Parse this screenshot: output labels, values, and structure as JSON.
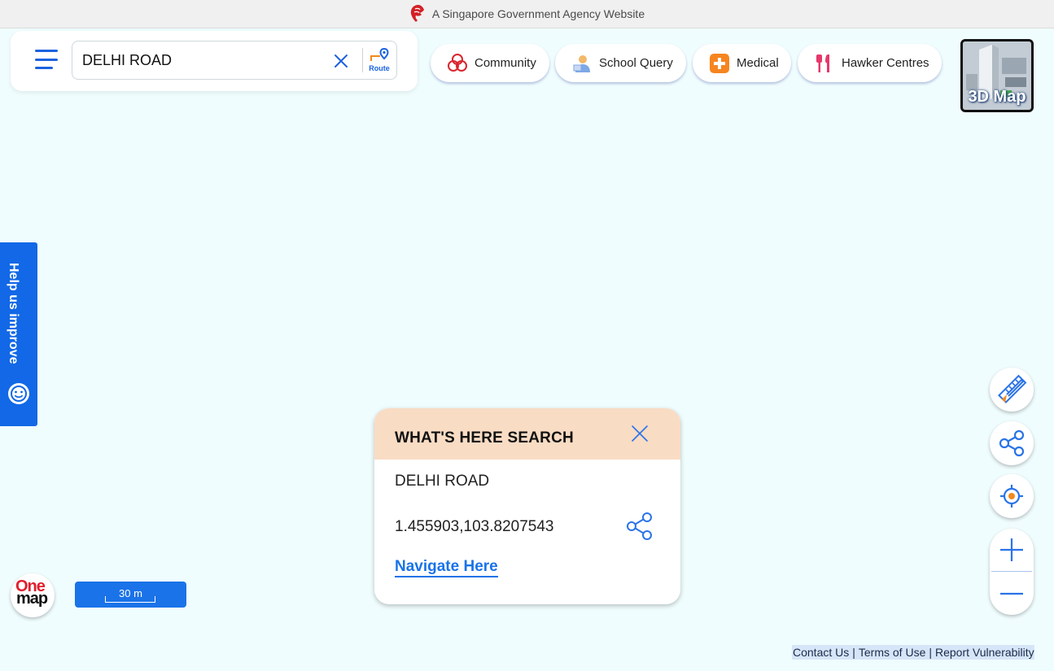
{
  "gov_banner": {
    "text": "A Singapore Government Agency Website"
  },
  "search": {
    "value": "DELHI ROAD",
    "route_label": "Route"
  },
  "chips": [
    {
      "label": "Community",
      "icon": "community-icon"
    },
    {
      "label": "School Query",
      "icon": "school-icon"
    },
    {
      "label": "Medical",
      "icon": "medical-icon"
    },
    {
      "label": "Hawker Centres",
      "icon": "hawker-icon"
    }
  ],
  "map_3d": {
    "label": "3D Map"
  },
  "help_tab": {
    "label": "Help us improve"
  },
  "popup": {
    "title": "WHAT'S HERE SEARCH",
    "place_name": "DELHI ROAD",
    "coordinates": "1.455903,103.8207543",
    "navigate_label": "Navigate Here"
  },
  "logo": {
    "top": "One",
    "bottom": "map"
  },
  "scale": {
    "label": "30 m"
  },
  "footer": {
    "contact": "Contact Us",
    "terms": "Terms of Use",
    "report": "Report Vulnerability",
    "separator": "|"
  },
  "colors": {
    "accent": "#1a73e8",
    "map_bg": "#f0fdfe",
    "popup_header": "#f9dcc4",
    "help_tab": "#1268e6"
  }
}
